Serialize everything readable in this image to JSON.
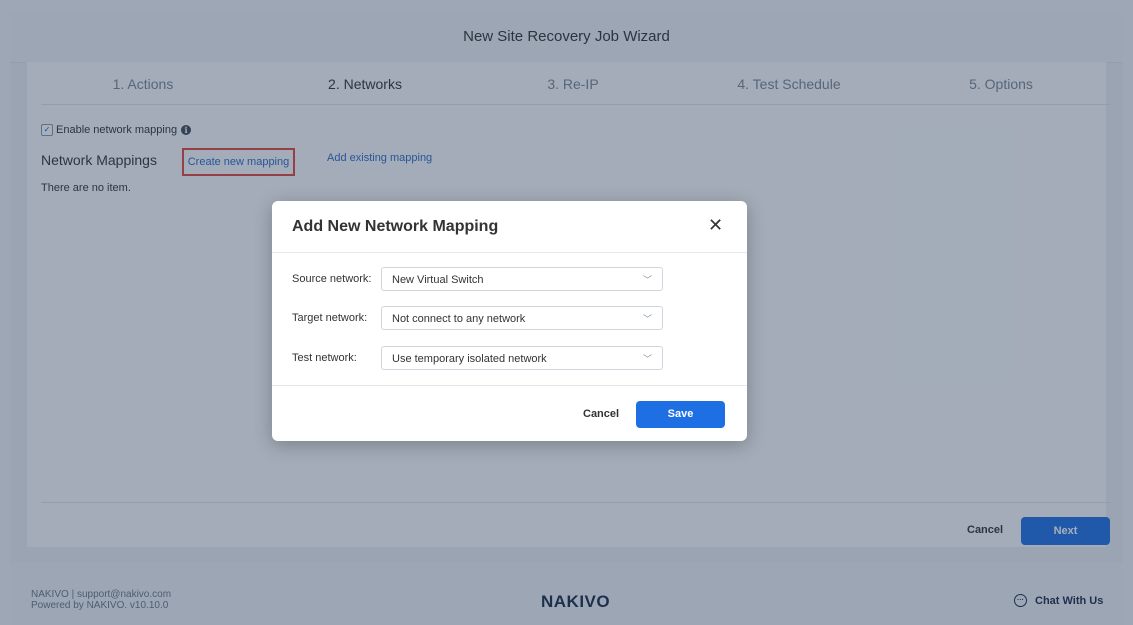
{
  "wizard": {
    "title": "New Site Recovery Job Wizard",
    "steps": [
      "1. Actions",
      "2. Networks",
      "3. Re-IP",
      "4. Test Schedule",
      "5. Options"
    ],
    "enable_mapping_label": "Enable network mapping",
    "mappings_title": "Network Mappings",
    "create_link": "Create new mapping",
    "add_link": "Add existing mapping",
    "empty_text": "There are no item.",
    "cancel_label": "Cancel",
    "next_label": "Next"
  },
  "modal": {
    "title": "Add New Network Mapping",
    "fields": [
      {
        "label": "Source network:",
        "value": "New Virtual Switch"
      },
      {
        "label": "Target network:",
        "value": "Not connect to any network"
      },
      {
        "label": "Test network:",
        "value": "Use temporary isolated network"
      }
    ],
    "cancel_label": "Cancel",
    "save_label": "Save"
  },
  "footer": {
    "line1": "NAKIVO | support@nakivo.com",
    "line2": "Powered by NAKIVO. v10.10.0",
    "logo": "NAKIVO",
    "chat_label": "Chat With Us"
  },
  "icons": {
    "info": "info-icon",
    "close": "close-icon",
    "chevron": "chevron-down-icon",
    "chat": "chat-icon",
    "checkbox": "checkbox-checked-icon"
  },
  "colors": {
    "accent": "#1e6fe3",
    "link": "#2a6bc7",
    "highlight": "#e0463c",
    "overlay": "#233755"
  }
}
